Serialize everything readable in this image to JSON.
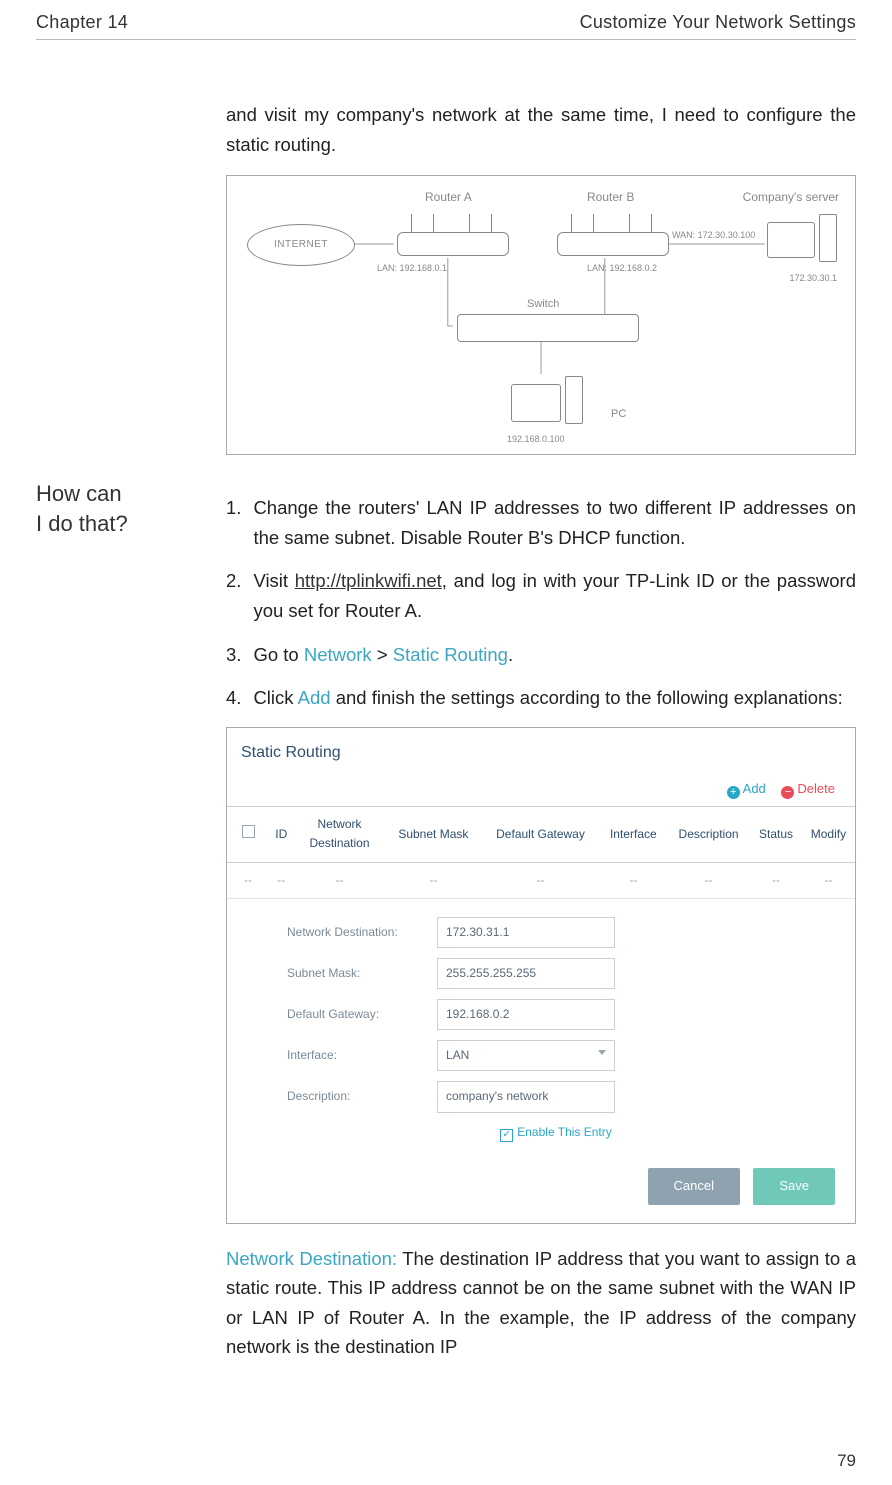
{
  "header": {
    "left": "Chapter 14",
    "right": "Customize Your Network Settings"
  },
  "intro_cont": "and visit my company's network at the same time, I need to configure the static routing.",
  "diagram": {
    "routerA": "Router A",
    "routerB": "Router B",
    "company": "Company's server",
    "internet": "INTERNET",
    "lanA": "LAN: 192.168.0.1",
    "lanB": "LAN: 192.168.0.2",
    "wanB": "WAN: 172.30.30.100",
    "serverIp": "172.30.30.1",
    "switch": "Switch",
    "pc": "PC",
    "pcIp": "192.168.0.100"
  },
  "sidebar": {
    "howcan": "How can\nI do that?"
  },
  "steps": {
    "s1num": "1.",
    "s1": "Change the routers' LAN IP addresses to two different IP addresses on the same subnet. Disable Router B's DHCP function.",
    "s2num": "2.",
    "s2a": "Visit ",
    "s2link": "http://tplinkwifi.net",
    "s2b": ", and log in with your TP-Link ID or the password you set for Router A.",
    "s3num": "3.",
    "s3a": "Go to ",
    "s3k1": "Network",
    "s3b": " > ",
    "s3k2": "Static Routing",
    "s3c": ".",
    "s4num": "4.",
    "s4a": "Click ",
    "s4k": "Add",
    "s4b": " and finish the settings according to the following explanations:"
  },
  "ui": {
    "panel_title": "Static Routing",
    "add": "Add",
    "delete": "Delete",
    "cols": {
      "id": "ID",
      "netdest": "Network Destination",
      "mask": "Subnet Mask",
      "gw": "Default Gateway",
      "iface": "Interface",
      "desc": "Description",
      "status": "Status",
      "modify": "Modify"
    },
    "placeholder": "--",
    "form": {
      "l_netdest": "Network Destination:",
      "v_netdest": "172.30.31.1",
      "l_mask": "Subnet Mask:",
      "v_mask": "255.255.255.255",
      "l_gw": "Default Gateway:",
      "v_gw": "192.168.0.2",
      "l_iface": "Interface:",
      "v_iface": "LAN",
      "l_desc": "Description:",
      "v_desc": "company's network",
      "enable": "Enable This Entry"
    },
    "cancel": "Cancel",
    "save": "Save"
  },
  "explain": {
    "label": "Network Destination:",
    "text": " The destination IP address that you want to assign to a static route. This IP address cannot be on the same subnet with the WAN IP or LAN IP of Router A. In the example, the IP address of the company network is the destination IP"
  },
  "page_number": "79"
}
